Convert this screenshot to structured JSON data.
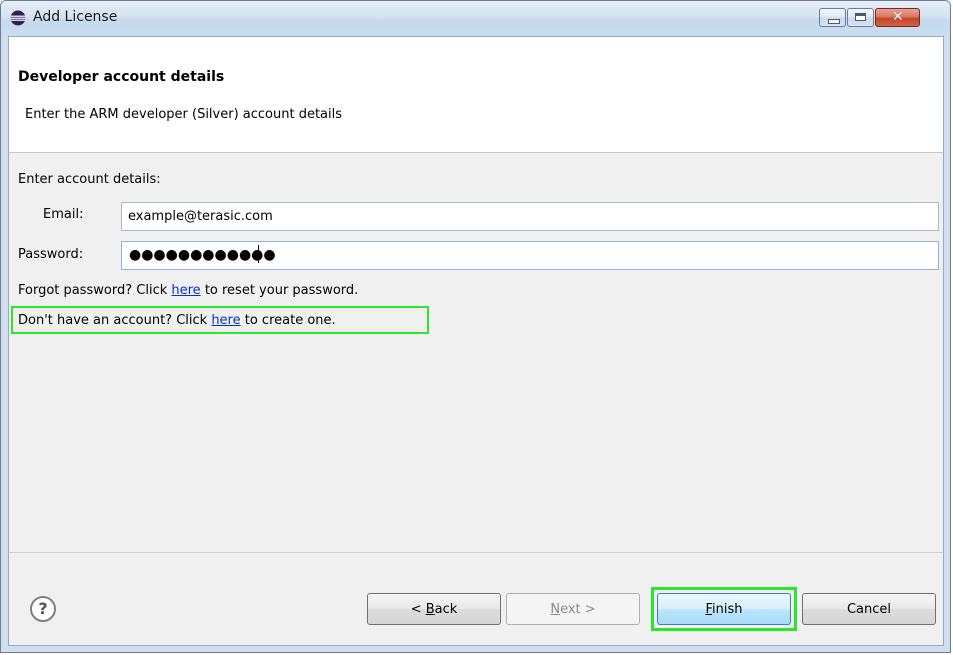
{
  "window": {
    "title": "Add License",
    "controls": {
      "minimize": "minimize",
      "maximize": "maximize",
      "close": "✕"
    }
  },
  "header": {
    "title": "Developer account details",
    "description": "Enter the ARM developer (Silver) account details"
  },
  "form": {
    "section_label": "Enter account details:",
    "email_label": "Email:",
    "email_value": "example@terasic.com",
    "password_label": "Password:",
    "password_masked": "●●●●●●●●●●●●"
  },
  "help_lines": {
    "forgot_prefix": "Forgot password? Click ",
    "forgot_link": "here",
    "forgot_suffix": " to reset your password.",
    "create_prefix": "Don't have an account? Click ",
    "create_link": "here",
    "create_suffix": " to create one."
  },
  "footer": {
    "help_glyph": "?",
    "back_pre": "< ",
    "back_mnemonic": "B",
    "back_rest": "ack",
    "next_mnemonic": "N",
    "next_rest": "ext >",
    "finish_mnemonic": "F",
    "finish_rest": "inish",
    "cancel_label": "Cancel"
  },
  "icons": {
    "app_icon": "eclipse-icon",
    "help_icon": "help-icon"
  },
  "colors": {
    "highlight": "#2ee52e",
    "link": "#0033cc",
    "title_bar": "#d5e3f2"
  }
}
